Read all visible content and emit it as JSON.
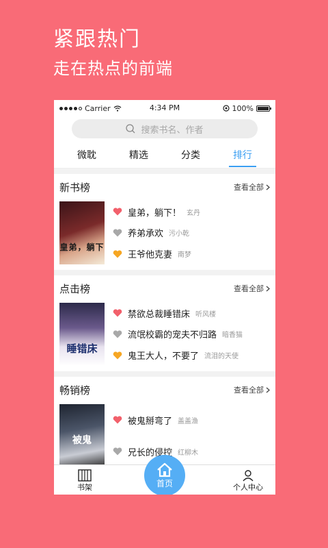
{
  "promo": {
    "title": "紧跟热门",
    "subtitle": "走在热点的前端"
  },
  "status": {
    "carrier": "Carrier",
    "time": "4:34 PM",
    "battery": "100%"
  },
  "search": {
    "placeholder": "搜索书名、作者"
  },
  "tabs": [
    {
      "label": "微耽",
      "active": false
    },
    {
      "label": "精选",
      "active": false
    },
    {
      "label": "分类",
      "active": false
    },
    {
      "label": "排行",
      "active": true
    }
  ],
  "sections": [
    {
      "title": "新书榜",
      "more": "查看全部",
      "cover_title": "皇弟，躺下",
      "items": [
        {
          "title": "皇弟，躺下！",
          "author": "玄丹",
          "heart_color": "#f2606b"
        },
        {
          "title": "养弟承欢",
          "author": "污小乾",
          "heart_color": "#a8a8a8"
        },
        {
          "title": "王爷他克妻",
          "author": "南梦",
          "heart_color": "#f6a623"
        }
      ]
    },
    {
      "title": "点击榜",
      "more": "查看全部",
      "cover_title": "睡错床",
      "items": [
        {
          "title": "禁欲总裁睡错床",
          "author": "听风楼",
          "heart_color": "#f2606b"
        },
        {
          "title": "流氓校霸的宠夫不归路",
          "author": "暗香猫",
          "heart_color": "#a8a8a8"
        },
        {
          "title": "鬼王大人，不要了",
          "author": "流泪的天使",
          "heart_color": "#f6a623"
        }
      ]
    },
    {
      "title": "畅销榜",
      "more": "查看全部",
      "cover_title": "被鬼",
      "items": [
        {
          "title": "被鬼掰弯了",
          "author": "盖盖渔",
          "heart_color": "#f2606b"
        },
        {
          "title": "兄长的侵控",
          "author": "红柳木",
          "heart_color": "#a8a8a8"
        }
      ]
    }
  ],
  "nav": {
    "shelf": "书架",
    "home": "首页",
    "profile": "个人中心"
  }
}
